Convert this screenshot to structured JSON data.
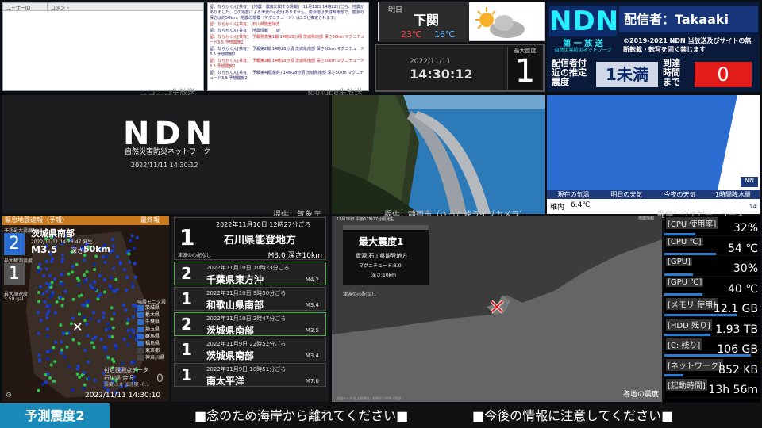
{
  "comments": {
    "col_user": "ユーザーID",
    "col_comment": "コメント"
  },
  "log": {
    "lines": [
      "留：ならかくん[共有]　[地震・震度に関する情報]　11月11日 14時22分ごろ、地震がありました。この地震による津波の心配はありません。震源地は茨城県南部で、震源の深さは約50km、地震の規模（マグニチュード）は3.5と推定されます。",
      "留：ならかくん[共有]　石川県能登地方",
      "留：ならかくん[共有]　地震情報　　続",
      "留：ならかくん[共有]　予報発表第1報 14時28分頃 茨城県南部 深さ50km マグニチュード3.5 予想震度2",
      "留：ならかくん[共有]　予報第2報 14時28分頃 茨城県南部 深さ50km マグニチュード3.5 予想震度2",
      "留：ならかくん[共有]　予報第3報 14時28分頃 茨城県南部 深さ50km マグニチュード3.5 予想震度2",
      "留：ならかくん[共有]　予報第4報(最終) 14時28分頃 茨城県南部 深さ50km マグニチュード3.5 予想震度2"
    ]
  },
  "captions": {
    "nico": "ニコニコ生放送",
    "youtube": "YouTube生放送",
    "jma": "提供：気象庁",
    "camera": "提供：静岡市（さった峠ライブカメラ）",
    "wn": "提供：ウェザーニュース"
  },
  "weather": {
    "city": "明日",
    "name": "下関",
    "high": "23℃",
    "low": "16℃"
  },
  "clock": {
    "date": "2022/11/11",
    "time": "14:30:12",
    "int_label": "最大震度",
    "intensity": "1"
  },
  "ndn": {
    "logo": "NDN",
    "broadcaster": "配信者：Takaaki",
    "first": "第 一 放 送",
    "sub": "自然災害防災ネットワーク",
    "copyright": "©2019-2021 NDN 当放送及びサイトの無断転載・転写を固く禁じます",
    "near_label": "配信者付近の推定震度",
    "near_value": "1未満",
    "arrival_label": "到達時間まで",
    "arrival_value": "0"
  },
  "stage": {
    "logo": "NDN",
    "sub": "自然災害防災ネットワーク",
    "time": "2022/11/11 14:30:12"
  },
  "wn": {
    "tabs": [
      "現在の気温",
      "明日の天気",
      "今夜の天気",
      "1時間降水量"
    ],
    "place": "稚内",
    "temp": "6.4℃",
    "logo": "NN",
    "time": "14:"
  },
  "eew": {
    "header": "緊急地震速報（予報）",
    "final": "最終報",
    "pred_label": "予想最大震度",
    "pred": "2",
    "region": "茨城県南部",
    "occur": "2022/11/11 14:28:47 発生",
    "mag": "M3.5",
    "depth_label": "深さ：",
    "depth": "50km",
    "obs_label": "最大観測震度",
    "obs": "1",
    "accel_label": "最大加速度",
    "accel": "3.59 gal",
    "legend_title": "強震モニタ震度",
    "legend": [
      "茨城県",
      "栃木県",
      "千葉県",
      "埼玉県",
      "群馬県",
      "福島県",
      "東京都",
      "神奈川県"
    ],
    "footer": "付近観測点データ",
    "loc": "石川県 金沢",
    "detail": "震度-3.0 加速度 -0.1",
    "count": "0",
    "time": "2022/11/11 14:30:10"
  },
  "quakes": {
    "top": {
      "time": "2022年11月10日 12時27分ごろ",
      "place": "石川県能登地方",
      "int": "1",
      "tsunami": "津波の心配なし",
      "mag": "M3.0 深さ10km"
    },
    "items": [
      {
        "time": "2022年11月10日 10時23分ごろ",
        "place": "千葉県東方沖",
        "int": "2",
        "mag": "M4.2"
      },
      {
        "time": "2022年11月10日 9時50分ごろ",
        "place": "和歌山県南部",
        "int": "1",
        "mag": "M3.4"
      },
      {
        "time": "2022年11月10日 2時47分ごろ",
        "place": "茨城県南部",
        "int": "2",
        "mag": "M3.5"
      },
      {
        "time": "2022年11月9日 22時52分ごろ",
        "place": "茨城県南部",
        "int": "1",
        "mag": "M3.4"
      },
      {
        "time": "2022年11月9日 18時51分ごろ",
        "place": "南太平洋",
        "int": "1",
        "mag": "M7.0"
      }
    ]
  },
  "qmap": {
    "header": "11月10日 午後12時27分頃発生",
    "corner": "地震情報",
    "title": "最大震度1",
    "epicenter": "震源:石川県能登地方",
    "mag": "マグニチュード:3.0",
    "depth": "深さ:10km",
    "tsunami": "津波の心配なし",
    "bottom": "各地の震度",
    "attr": "地図データ:国土地理院 / 気象庁 / NHK / 民放"
  },
  "sys": [
    {
      "label": "[CPU 使用率]",
      "value": "32%",
      "level": 0.32
    },
    {
      "label": "[CPU ℃]",
      "value": "54 ℃",
      "level": 0.54
    },
    {
      "label": "[GPU]",
      "value": "30%",
      "level": 0.3
    },
    {
      "label": "[GPU ℃]",
      "value": "40 ℃",
      "level": 0.4
    },
    {
      "label": "[メモリ 使用]",
      "value": "12.1 GB",
      "level": 0.75
    },
    {
      "label": "[HDD 残り]",
      "value": "1.93 TB",
      "level": 0.48
    },
    {
      "label": "[C: 残り]",
      "value": "106 GB",
      "level": 0.9
    },
    {
      "label": "[ネットワーク]",
      "value": "852 KB",
      "level": 0.2
    },
    {
      "label": "[起動時間]",
      "value": "13h 56m",
      "level": 0.0
    }
  ],
  "ticker": {
    "pred": "予測震度2",
    "msg1": "■念のため海岸から離れてください■",
    "msg2": "■今後の情報に注意してください■"
  },
  "colors": {
    "accent": "#1a8ab8",
    "red": "#e21b1b",
    "ndn": "#26f0ff"
  }
}
